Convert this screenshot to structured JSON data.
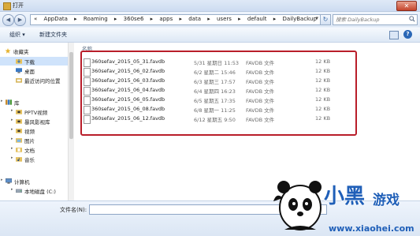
{
  "window": {
    "title": "打开",
    "close_glyph": "✕"
  },
  "nav": {
    "back_glyph": "◀",
    "forward_glyph": "▶",
    "breadcrumbs": [
      "«",
      "AppData",
      "▸",
      "Roaming",
      "▸",
      "360se6",
      "▸",
      "apps",
      "▸",
      "data",
      "▸",
      "users",
      "▸",
      "default",
      "▸",
      "DailyBackup"
    ],
    "address_arrow": "▾",
    "refresh_glyph": "↻",
    "search_placeholder": "搜索 DailyBackup"
  },
  "toolbar": {
    "organize_label": "组织 ▾",
    "new_folder_label": "新建文件夹",
    "help_glyph": "?"
  },
  "sidebar": {
    "items": [
      {
        "label": "收藏夹",
        "icon": "star-icon"
      },
      {
        "label": "下载",
        "icon": "download-folder-icon"
      },
      {
        "label": "桌面",
        "icon": "desktop-icon"
      },
      {
        "label": "最近访问的位置",
        "icon": "recent-places-icon"
      },
      {
        "label": "库",
        "icon": "library-icon"
      },
      {
        "label": "PPTV视频",
        "icon": "video-folder-icon"
      },
      {
        "label": "暴风影视库",
        "icon": "video-folder-icon"
      },
      {
        "label": "视频",
        "icon": "video-folder-icon"
      },
      {
        "label": "图片",
        "icon": "pictures-folder-icon"
      },
      {
        "label": "文档",
        "icon": "documents-folder-icon"
      },
      {
        "label": "音乐",
        "icon": "music-icon"
      },
      {
        "label": "计算机",
        "icon": "computer-icon"
      },
      {
        "label": "本地磁盘 (C:)",
        "icon": "drive-icon"
      }
    ]
  },
  "files": {
    "column_header": "名称",
    "rows": [
      {
        "name": "360sefav_2015_05_31.favdb",
        "date": "5/31 星期日 11:53",
        "type": "FAVDB 文件",
        "size": "12 KB"
      },
      {
        "name": "360sefav_2015_06_02.favdb",
        "date": "6/2 星期二 15:46",
        "type": "FAVDB 文件",
        "size": "12 KB"
      },
      {
        "name": "360sefav_2015_06_03.favdb",
        "date": "6/3 星期三 17:57",
        "type": "FAVDB 文件",
        "size": "12 KB"
      },
      {
        "name": "360sefav_2015_06_04.favdb",
        "date": "6/4 星期四 16:23",
        "type": "FAVDB 文件",
        "size": "12 KB"
      },
      {
        "name": "360sefav_2015_06_05.favdb",
        "date": "6/5 星期五 17:35",
        "type": "FAVDB 文件",
        "size": "12 KB"
      },
      {
        "name": "360sefav_2015_06_08.favdb",
        "date": "6/8 星期一 11:25",
        "type": "FAVDB 文件",
        "size": "12 KB"
      },
      {
        "name": "360sefav_2015_06_12.favdb",
        "date": "6/12 星期五 9:50",
        "type": "FAVDB 文件",
        "size": "12 KB"
      }
    ]
  },
  "bottom": {
    "filename_label": "文件名(N):",
    "filename_value": ""
  },
  "watermark": {
    "brand": "小黑游戏",
    "url": "www.xiaohei.com"
  },
  "colors": {
    "highlight_border": "#b91e2a",
    "brand_blue": "#1f5fb8"
  }
}
